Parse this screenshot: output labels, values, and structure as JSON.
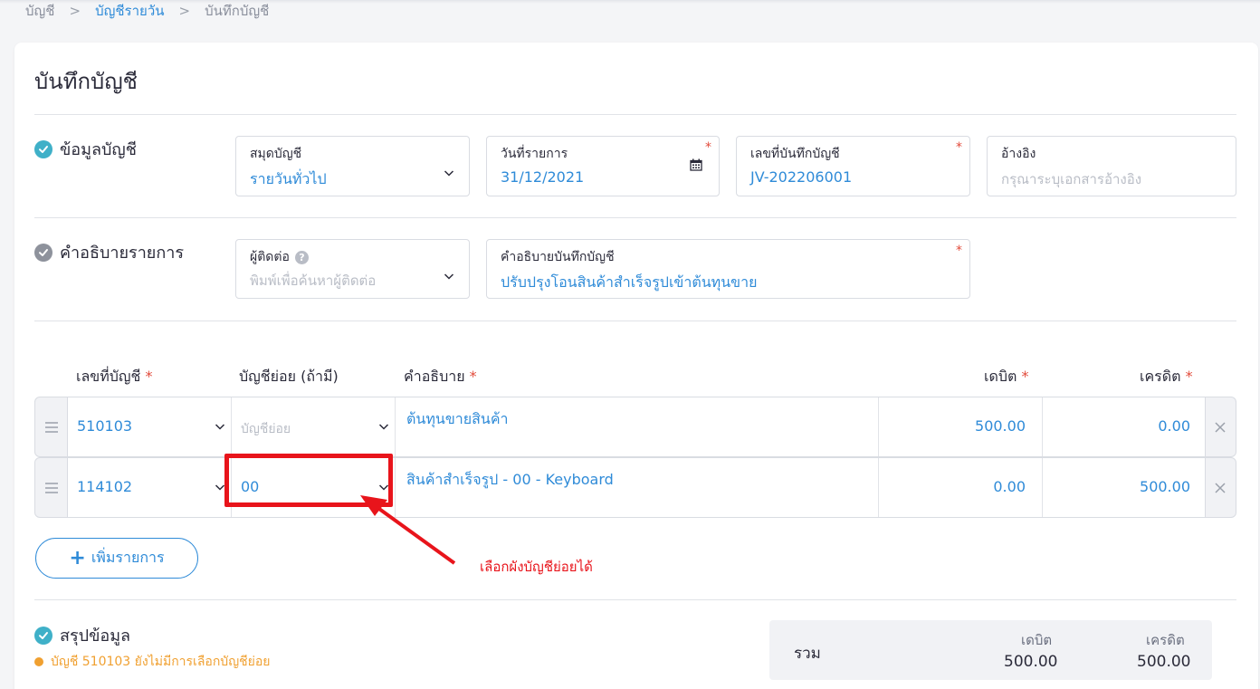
{
  "breadcrumb": {
    "root": "บัญชี",
    "sep1": ">",
    "daily": "บัญชีรายวัน",
    "sep2": ">",
    "current": "บันทึกบัญชี"
  },
  "page": {
    "title": "บันทึกบัญชี"
  },
  "account_info": {
    "section_label": "ข้อมูลบัญชี",
    "journal": {
      "label": "สมุดบัญชี",
      "value": "รายวันทั่วไป"
    },
    "date": {
      "label": "วันที่รายการ",
      "value": "31/12/2021",
      "required": "*"
    },
    "doc_no": {
      "label": "เลขที่บันทึกบัญชี",
      "value": "JV-202206001",
      "required": "*"
    },
    "reference": {
      "label": "อ้างอิง",
      "placeholder": "กรุณาระบุเอกสารอ้างอิง"
    }
  },
  "description_section": {
    "section_label": "คำอธิบายรายการ",
    "contact": {
      "label": "ผู้ติดต่อ",
      "help": "?",
      "placeholder": "พิมพ์เพื่อค้นหาผู้ติดต่อ"
    },
    "memo": {
      "label": "คำอธิบายบันทึกบัญชี",
      "value": "ปรับปรุงโอนสินค้าสำเร็จรูปเข้าต้นทุนขาย",
      "required": "*"
    }
  },
  "table": {
    "headers": {
      "account": "เลขที่บัญชี",
      "sub": "บัญชีย่อย (ถ้ามี)",
      "desc": "คำอธิบาย",
      "debit": "เดบิต",
      "credit": "เครดิต",
      "star": "*"
    },
    "rows": [
      {
        "account": "510103",
        "sub_placeholder": "บัญชีย่อย",
        "desc": "ต้นทุนขายสินค้า",
        "debit": "500.00",
        "credit": "0.00"
      },
      {
        "account": "114102",
        "sub": "00",
        "desc": "สินค้าสำเร็จรูป - 00 - Keyboard",
        "debit": "0.00",
        "credit": "500.00"
      }
    ],
    "add_button": "เพิ่มรายการ"
  },
  "annotation": {
    "note": "เลือกผังบัญชีย่อยได้",
    "color": "#e8141b"
  },
  "summary": {
    "section_label": "สรุปข้อมูล",
    "warning": "บัญชี 510103 ยังไม่มีการเลือกบัญชีย่อย",
    "total_label": "รวม",
    "debit_label": "เดบิต",
    "credit_label": "เครดิต",
    "debit_total": "500.00",
    "credit_total": "500.00"
  },
  "colors": {
    "accent": "#2f8bd8",
    "check": "#3fb0c8",
    "required": "#e24b3b",
    "warning": "#f0a030"
  }
}
